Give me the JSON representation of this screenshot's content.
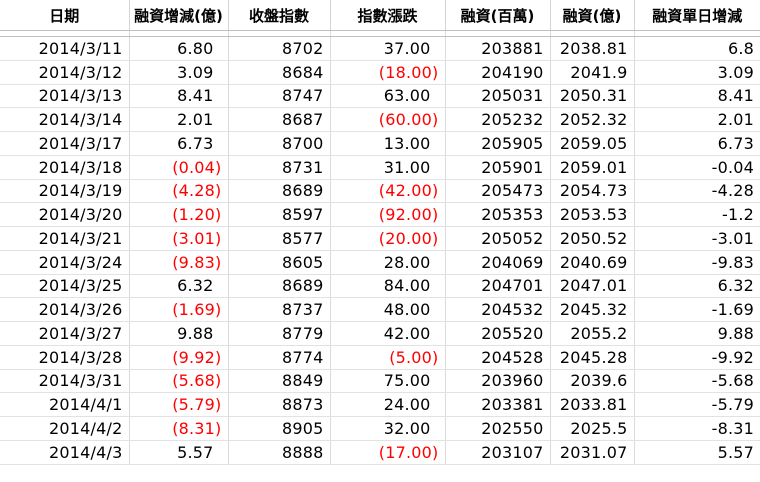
{
  "headers": [
    "日期",
    "融資增減(億)",
    "收盤指數",
    "指數漲跌",
    "融資(百萬)",
    "融資(億)",
    "融資單日增減"
  ],
  "rows": [
    {
      "date": "2014/3/11",
      "change_yi": "6.80",
      "change_neg": false,
      "index": "8702",
      "index_chg": "37.00",
      "index_chg_neg": false,
      "margin_m": "203881",
      "margin_yi": "2038.81",
      "daily": "6.8"
    },
    {
      "date": "2014/3/12",
      "change_yi": "3.09",
      "change_neg": false,
      "index": "8684",
      "index_chg": "(18.00)",
      "index_chg_neg": true,
      "margin_m": "204190",
      "margin_yi": "2041.9",
      "daily": "3.09"
    },
    {
      "date": "2014/3/13",
      "change_yi": "8.41",
      "change_neg": false,
      "index": "8747",
      "index_chg": "63.00",
      "index_chg_neg": false,
      "margin_m": "205031",
      "margin_yi": "2050.31",
      "daily": "8.41"
    },
    {
      "date": "2014/3/14",
      "change_yi": "2.01",
      "change_neg": false,
      "index": "8687",
      "index_chg": "(60.00)",
      "index_chg_neg": true,
      "margin_m": "205232",
      "margin_yi": "2052.32",
      "daily": "2.01"
    },
    {
      "date": "2014/3/17",
      "change_yi": "6.73",
      "change_neg": false,
      "index": "8700",
      "index_chg": "13.00",
      "index_chg_neg": false,
      "margin_m": "205905",
      "margin_yi": "2059.05",
      "daily": "6.73"
    },
    {
      "date": "2014/3/18",
      "change_yi": "(0.04)",
      "change_neg": true,
      "index": "8731",
      "index_chg": "31.00",
      "index_chg_neg": false,
      "margin_m": "205901",
      "margin_yi": "2059.01",
      "daily": "-0.04"
    },
    {
      "date": "2014/3/19",
      "change_yi": "(4.28)",
      "change_neg": true,
      "index": "8689",
      "index_chg": "(42.00)",
      "index_chg_neg": true,
      "margin_m": "205473",
      "margin_yi": "2054.73",
      "daily": "-4.28"
    },
    {
      "date": "2014/3/20",
      "change_yi": "(1.20)",
      "change_neg": true,
      "index": "8597",
      "index_chg": "(92.00)",
      "index_chg_neg": true,
      "margin_m": "205353",
      "margin_yi": "2053.53",
      "daily": "-1.2"
    },
    {
      "date": "2014/3/21",
      "change_yi": "(3.01)",
      "change_neg": true,
      "index": "8577",
      "index_chg": "(20.00)",
      "index_chg_neg": true,
      "margin_m": "205052",
      "margin_yi": "2050.52",
      "daily": "-3.01"
    },
    {
      "date": "2014/3/24",
      "change_yi": "(9.83)",
      "change_neg": true,
      "index": "8605",
      "index_chg": "28.00",
      "index_chg_neg": false,
      "margin_m": "204069",
      "margin_yi": "2040.69",
      "daily": "-9.83"
    },
    {
      "date": "2014/3/25",
      "change_yi": "6.32",
      "change_neg": false,
      "index": "8689",
      "index_chg": "84.00",
      "index_chg_neg": false,
      "margin_m": "204701",
      "margin_yi": "2047.01",
      "daily": "6.32"
    },
    {
      "date": "2014/3/26",
      "change_yi": "(1.69)",
      "change_neg": true,
      "index": "8737",
      "index_chg": "48.00",
      "index_chg_neg": false,
      "margin_m": "204532",
      "margin_yi": "2045.32",
      "daily": "-1.69"
    },
    {
      "date": "2014/3/27",
      "change_yi": "9.88",
      "change_neg": false,
      "index": "8779",
      "index_chg": "42.00",
      "index_chg_neg": false,
      "margin_m": "205520",
      "margin_yi": "2055.2",
      "daily": "9.88"
    },
    {
      "date": "2014/3/28",
      "change_yi": "(9.92)",
      "change_neg": true,
      "index": "8774",
      "index_chg": "(5.00)",
      "index_chg_neg": true,
      "margin_m": "204528",
      "margin_yi": "2045.28",
      "daily": "-9.92"
    },
    {
      "date": "2014/3/31",
      "change_yi": "(5.68)",
      "change_neg": true,
      "index": "8849",
      "index_chg": "75.00",
      "index_chg_neg": false,
      "margin_m": "203960",
      "margin_yi": "2039.6",
      "daily": "-5.68"
    },
    {
      "date": "2014/4/1",
      "change_yi": "(5.79)",
      "change_neg": true,
      "index": "8873",
      "index_chg": "24.00",
      "index_chg_neg": false,
      "margin_m": "203381",
      "margin_yi": "2033.81",
      "daily": "-5.79"
    },
    {
      "date": "2014/4/2",
      "change_yi": "(8.31)",
      "change_neg": true,
      "index": "8905",
      "index_chg": "32.00",
      "index_chg_neg": false,
      "margin_m": "202550",
      "margin_yi": "2025.5",
      "daily": "-8.31"
    },
    {
      "date": "2014/4/3",
      "change_yi": "5.57",
      "change_neg": false,
      "index": "8888",
      "index_chg": "(17.00)",
      "index_chg_neg": true,
      "margin_m": "203107",
      "margin_yi": "2031.07",
      "daily": "5.57"
    }
  ],
  "colors": {
    "negative": "#ff0000",
    "text": "#000000",
    "grid": "#dadada"
  }
}
